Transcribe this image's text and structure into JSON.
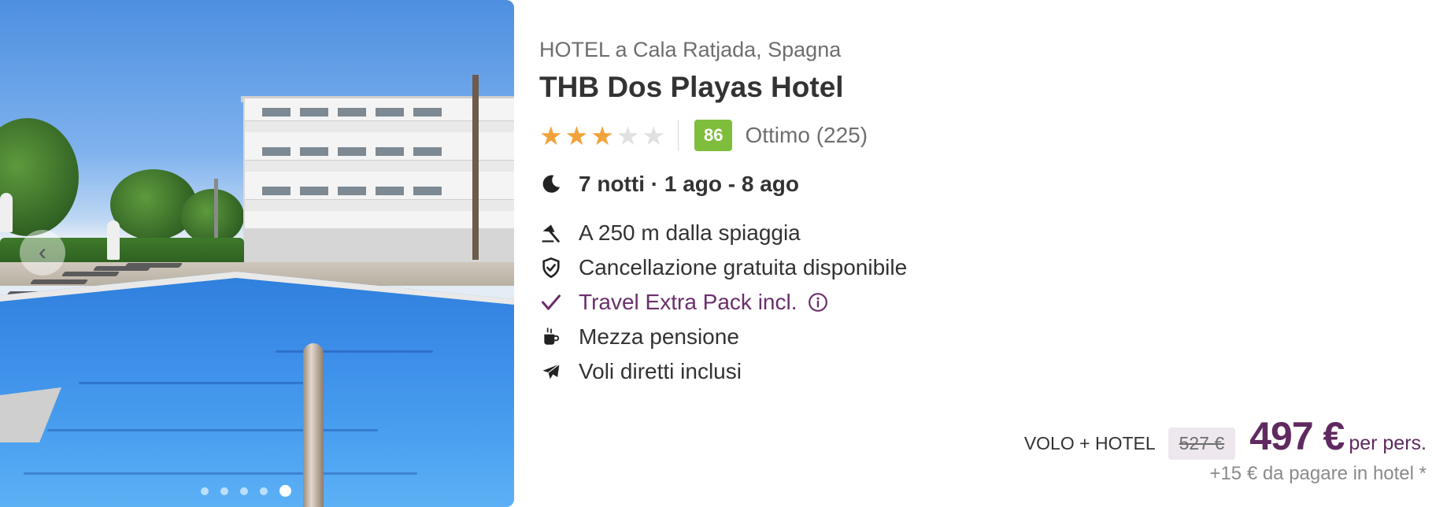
{
  "hotel": {
    "location": "HOTEL a Cala Ratjada, Spagna",
    "name": "THB Dos Playas Hotel",
    "stars": 3,
    "stars_max": 5,
    "score": "86",
    "score_label": "Ottimo (225)"
  },
  "stay": {
    "dates": "7 notti · 1 ago - 8 ago"
  },
  "features": [
    {
      "icon": "beach-umbrella-icon",
      "label": "A 250 m dalla spiaggia"
    },
    {
      "icon": "shield-check-icon",
      "label": "Cancellazione gratuita disponibile"
    },
    {
      "icon": "check-icon",
      "label": "Travel Extra Pack incl."
    },
    {
      "icon": "coffee-cup-icon",
      "label": "Mezza pensione"
    },
    {
      "icon": "airplane-icon",
      "label": "Voli diretti inclusi"
    }
  ],
  "price": {
    "package_label": "VOLO + HOTEL",
    "old_price": "527 €",
    "new_price": "497 €",
    "per_person": "per pers.",
    "extra_fee": "+15 € da pagare in hotel *"
  },
  "gallery": {
    "dot_count": 5,
    "active_dot": 5
  },
  "colors": {
    "accent": "#5f2a60",
    "star": "#f2a23a",
    "score_bg": "#7fbd3d"
  }
}
